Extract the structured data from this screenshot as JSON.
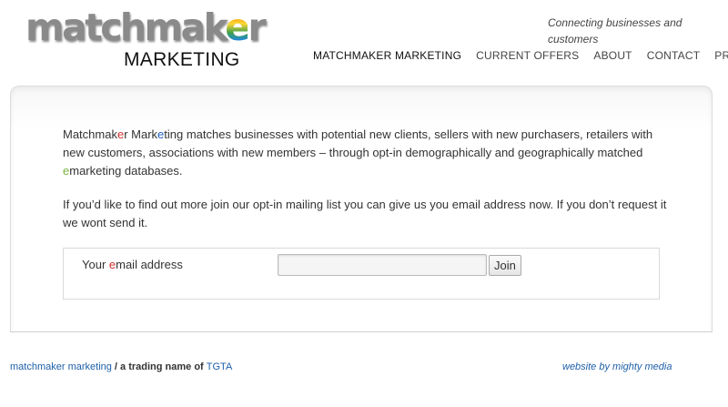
{
  "logo": {
    "top_prefix": "matchmak",
    "top_highlight": "e",
    "top_suffix": "r",
    "bottom": "MARKETING"
  },
  "tagline": "Connecting businesses and customers",
  "nav": [
    {
      "label": "MATCHMAKER MARKETING",
      "active": true
    },
    {
      "label": "CURRENT OFFERS"
    },
    {
      "label": "ABOUT"
    },
    {
      "label": "CONTACT"
    },
    {
      "label": "PRIVACY"
    }
  ],
  "intro": {
    "seg1": "Matchmak",
    "seg2": "e",
    "seg3": "r Mark",
    "seg4": "e",
    "seg5": "ting matches businesses with potential new clients, sellers with new purchasers, retailers with new customers, associations with new members – through opt-in demographically and geographically matched ",
    "seg6": "e",
    "seg7": "marketing databases."
  },
  "signup_text": "If you’d like to find out more join our opt-in mailing list you can give us you email address now.  If you don’t request it we wont send it.",
  "form": {
    "label_pre": "Your ",
    "label_hl": "e",
    "label_post": "mail address",
    "email_value": "",
    "join_label": "Join"
  },
  "footer": {
    "brand_link": "matchmaker marketing",
    "middle": " / a trading name of ",
    "org_link": "TGTA",
    "credit": "website by mighty media"
  },
  "colors": {
    "highlight_red": "#d32f2f",
    "highlight_blue": "#1e5fc2",
    "highlight_green": "#7cb342",
    "link": "#1e5fa8"
  }
}
